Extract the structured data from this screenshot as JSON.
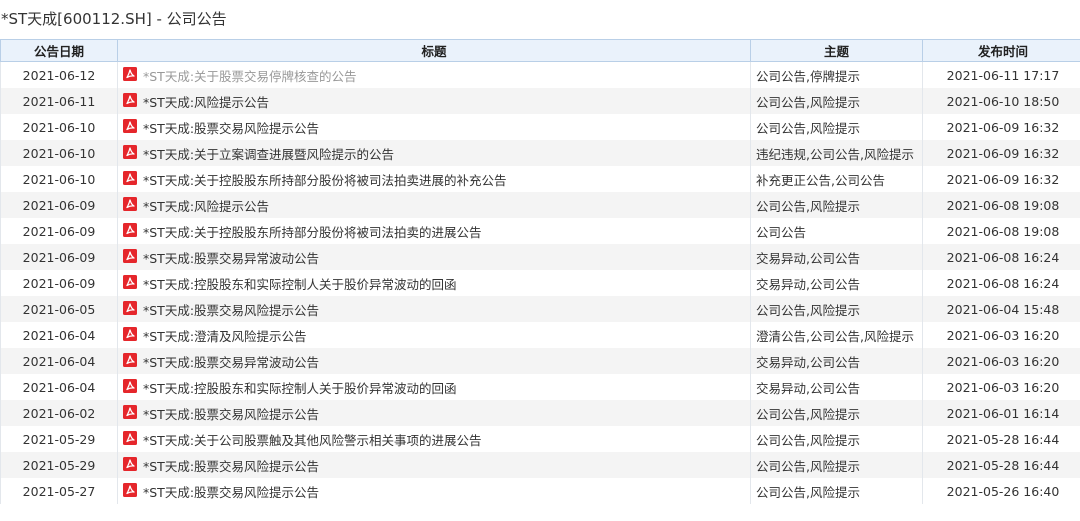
{
  "page": {
    "title": "*ST天成[600112.SH] - 公司公告"
  },
  "table": {
    "headers": {
      "date": "公告日期",
      "title": "标题",
      "topic": "主题",
      "time": "发布时间"
    },
    "rows": [
      {
        "date": "2021-06-12",
        "title": "*ST天成:关于股票交易停牌核查的公告",
        "topic": "公司公告,停牌提示",
        "time": "2021-06-11 17:17",
        "visited": true
      },
      {
        "date": "2021-06-11",
        "title": "*ST天成:风险提示公告",
        "topic": "公司公告,风险提示",
        "time": "2021-06-10 18:50"
      },
      {
        "date": "2021-06-10",
        "title": "*ST天成:股票交易风险提示公告",
        "topic": "公司公告,风险提示",
        "time": "2021-06-09 16:32"
      },
      {
        "date": "2021-06-10",
        "title": "*ST天成:关于立案调查进展暨风险提示的公告",
        "topic": "违纪违规,公司公告,风险提示",
        "time": "2021-06-09 16:32"
      },
      {
        "date": "2021-06-10",
        "title": "*ST天成:关于控股股东所持部分股份将被司法拍卖进展的补充公告",
        "topic": "补充更正公告,公司公告",
        "time": "2021-06-09 16:32"
      },
      {
        "date": "2021-06-09",
        "title": "*ST天成:风险提示公告",
        "topic": "公司公告,风险提示",
        "time": "2021-06-08 19:08"
      },
      {
        "date": "2021-06-09",
        "title": "*ST天成:关于控股股东所持部分股份将被司法拍卖的进展公告",
        "topic": "公司公告",
        "time": "2021-06-08 19:08"
      },
      {
        "date": "2021-06-09",
        "title": "*ST天成:股票交易异常波动公告",
        "topic": "交易异动,公司公告",
        "time": "2021-06-08 16:24"
      },
      {
        "date": "2021-06-09",
        "title": "*ST天成:控股股东和实际控制人关于股价异常波动的回函",
        "topic": "交易异动,公司公告",
        "time": "2021-06-08 16:24"
      },
      {
        "date": "2021-06-05",
        "title": "*ST天成:股票交易风险提示公告",
        "topic": "公司公告,风险提示",
        "time": "2021-06-04 15:48"
      },
      {
        "date": "2021-06-04",
        "title": "*ST天成:澄清及风险提示公告",
        "topic": "澄清公告,公司公告,风险提示",
        "time": "2021-06-03 16:20"
      },
      {
        "date": "2021-06-04",
        "title": "*ST天成:股票交易异常波动公告",
        "topic": "交易异动,公司公告",
        "time": "2021-06-03 16:20"
      },
      {
        "date": "2021-06-04",
        "title": "*ST天成:控股股东和实际控制人关于股价异常波动的回函",
        "topic": "交易异动,公司公告",
        "time": "2021-06-03 16:20"
      },
      {
        "date": "2021-06-02",
        "title": "*ST天成:股票交易风险提示公告",
        "topic": "公司公告,风险提示",
        "time": "2021-06-01 16:14"
      },
      {
        "date": "2021-05-29",
        "title": "*ST天成:关于公司股票触及其他风险警示相关事项的进展公告",
        "topic": "公司公告,风险提示",
        "time": "2021-05-28 16:44"
      },
      {
        "date": "2021-05-29",
        "title": "*ST天成:股票交易风险提示公告",
        "topic": "公司公告,风险提示",
        "time": "2021-05-28 16:44"
      },
      {
        "date": "2021-05-27",
        "title": "*ST天成:股票交易风险提示公告",
        "topic": "公司公告,风险提示",
        "time": "2021-05-26 16:40"
      }
    ]
  },
  "icons": {
    "row_icon": "pdf-icon",
    "pdf_color": "#e5262b"
  },
  "colors": {
    "header_bg": "#eaf2fb",
    "header_border": "#b9cfe7",
    "visited_link": "#999999"
  }
}
